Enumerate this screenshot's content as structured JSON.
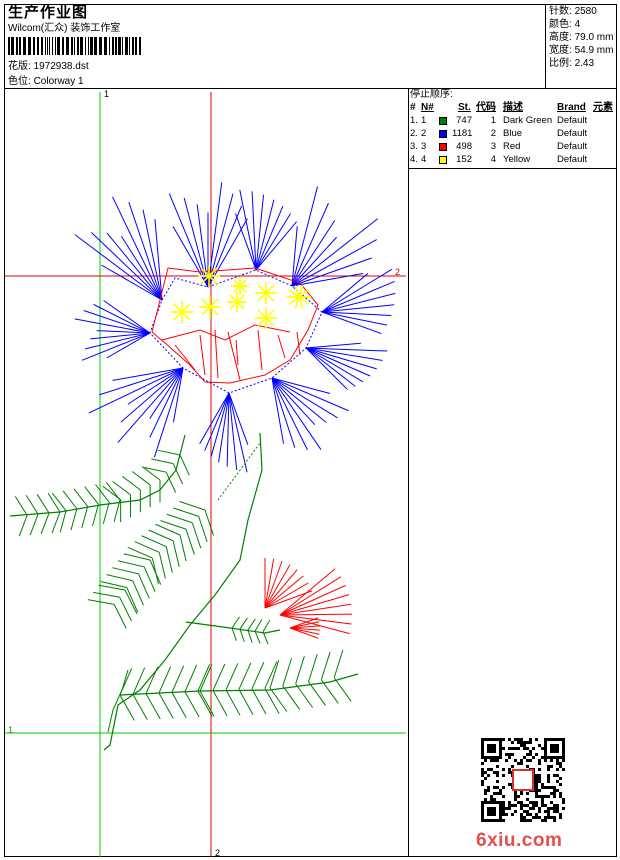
{
  "header": {
    "title": "生产作业图",
    "company": "Wilcom(汇众) 装饰工作室",
    "design_label": "花版:",
    "design_value": "1972938.dst",
    "colorway_label": "色位:",
    "colorway_value": "Colorway 1"
  },
  "stats": [
    {
      "label": "针数:",
      "value": "2580"
    },
    {
      "label": "颜色:",
      "value": "4"
    },
    {
      "label": "高度:",
      "value": "79.0 mm"
    },
    {
      "label": "宽度:",
      "value": "54.9 mm"
    },
    {
      "label": "比例:",
      "value": "2.43"
    }
  ],
  "sequence": {
    "title": "停止顺序:",
    "headers": {
      "hash": "#",
      "n": "N#",
      "st": "St.",
      "code": "代码",
      "desc": "描述",
      "brand": "Brand",
      "elem": "元素"
    },
    "rows": [
      {
        "idx": "1.",
        "n": "1",
        "color": "#008000",
        "st": "747",
        "code": "1",
        "desc": "Dark Green",
        "brand": "Default"
      },
      {
        "idx": "2.",
        "n": "2",
        "color": "#0000ff",
        "st": "1181",
        "code": "2",
        "desc": "Blue",
        "brand": "Default"
      },
      {
        "idx": "3.",
        "n": "3",
        "color": "#ff0000",
        "st": "498",
        "code": "3",
        "desc": "Red",
        "brand": "Default"
      },
      {
        "idx": "4.",
        "n": "4",
        "color": "#ffff00",
        "st": "152",
        "code": "4",
        "desc": "Yellow",
        "brand": "Default"
      }
    ]
  },
  "guides": {
    "v1": "1",
    "v2": "2",
    "h1": "1",
    "h2": "2"
  },
  "watermark": "6xiu.com",
  "colors": {
    "green": "#008000",
    "blue": "#0000ff",
    "red": "#ff0000",
    "yellow": "#ffff00",
    "guide_green": "#00c800",
    "guide_red": "#e00000"
  }
}
